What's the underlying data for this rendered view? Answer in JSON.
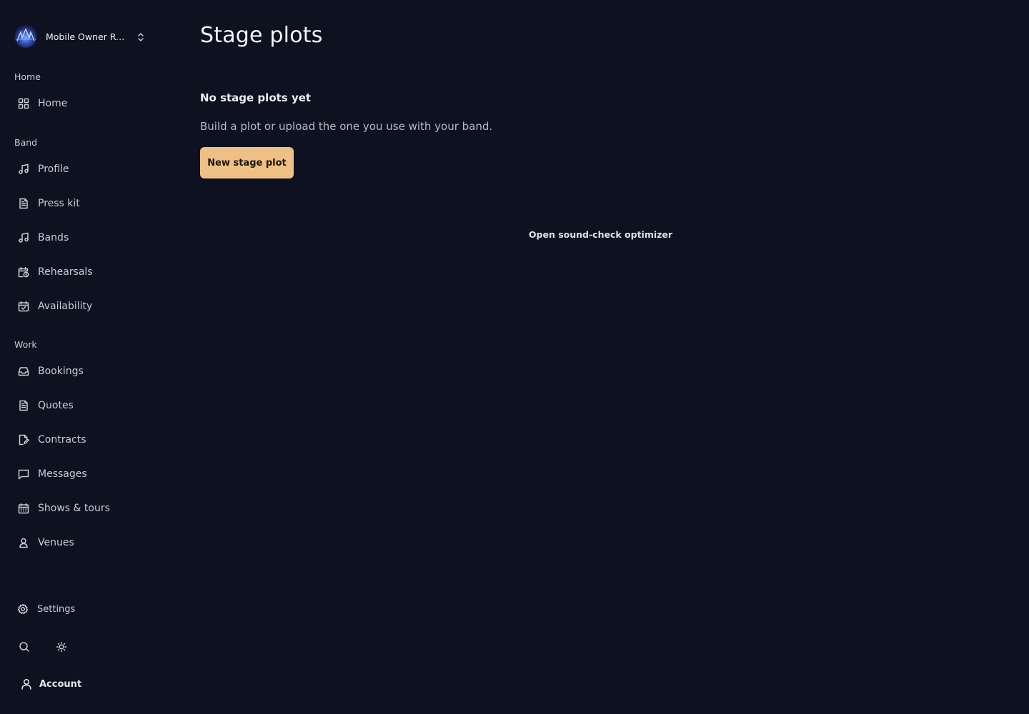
{
  "org": {
    "name": "Mobile Owner Re..."
  },
  "sidebar": {
    "sections": [
      {
        "label": "Home"
      },
      {
        "label": "Band"
      },
      {
        "label": "Work"
      }
    ],
    "items": [
      {
        "label": "Home",
        "icon": "dashboard-icon"
      },
      {
        "label": "Profile",
        "icon": "music-note-icon"
      },
      {
        "label": "Press kit",
        "icon": "document-icon"
      },
      {
        "label": "Bands",
        "icon": "music-note-icon"
      },
      {
        "label": "Rehearsals",
        "icon": "calendar-clock-icon"
      },
      {
        "label": "Availability",
        "icon": "calendar-check-icon"
      },
      {
        "label": "Bookings",
        "icon": "inbox-icon"
      },
      {
        "label": "Quotes",
        "icon": "document-icon"
      },
      {
        "label": "Contracts",
        "icon": "file-signature-icon"
      },
      {
        "label": "Messages",
        "icon": "message-square-icon"
      },
      {
        "label": "Shows & tours",
        "icon": "calendar-grid-icon"
      },
      {
        "label": "Venues",
        "icon": "map-pin-user-icon"
      }
    ],
    "settings_label": "Settings",
    "account_label": "Account"
  },
  "main": {
    "title": "Stage plots",
    "empty_title": "No stage plots yet",
    "empty_description": "Build a plot or upload the one you use with your band.",
    "primary_button": "New stage plot",
    "secondary_link": "Open sound-check optimizer"
  },
  "colors": {
    "background": "#0d1120",
    "accent": "#efc086"
  }
}
